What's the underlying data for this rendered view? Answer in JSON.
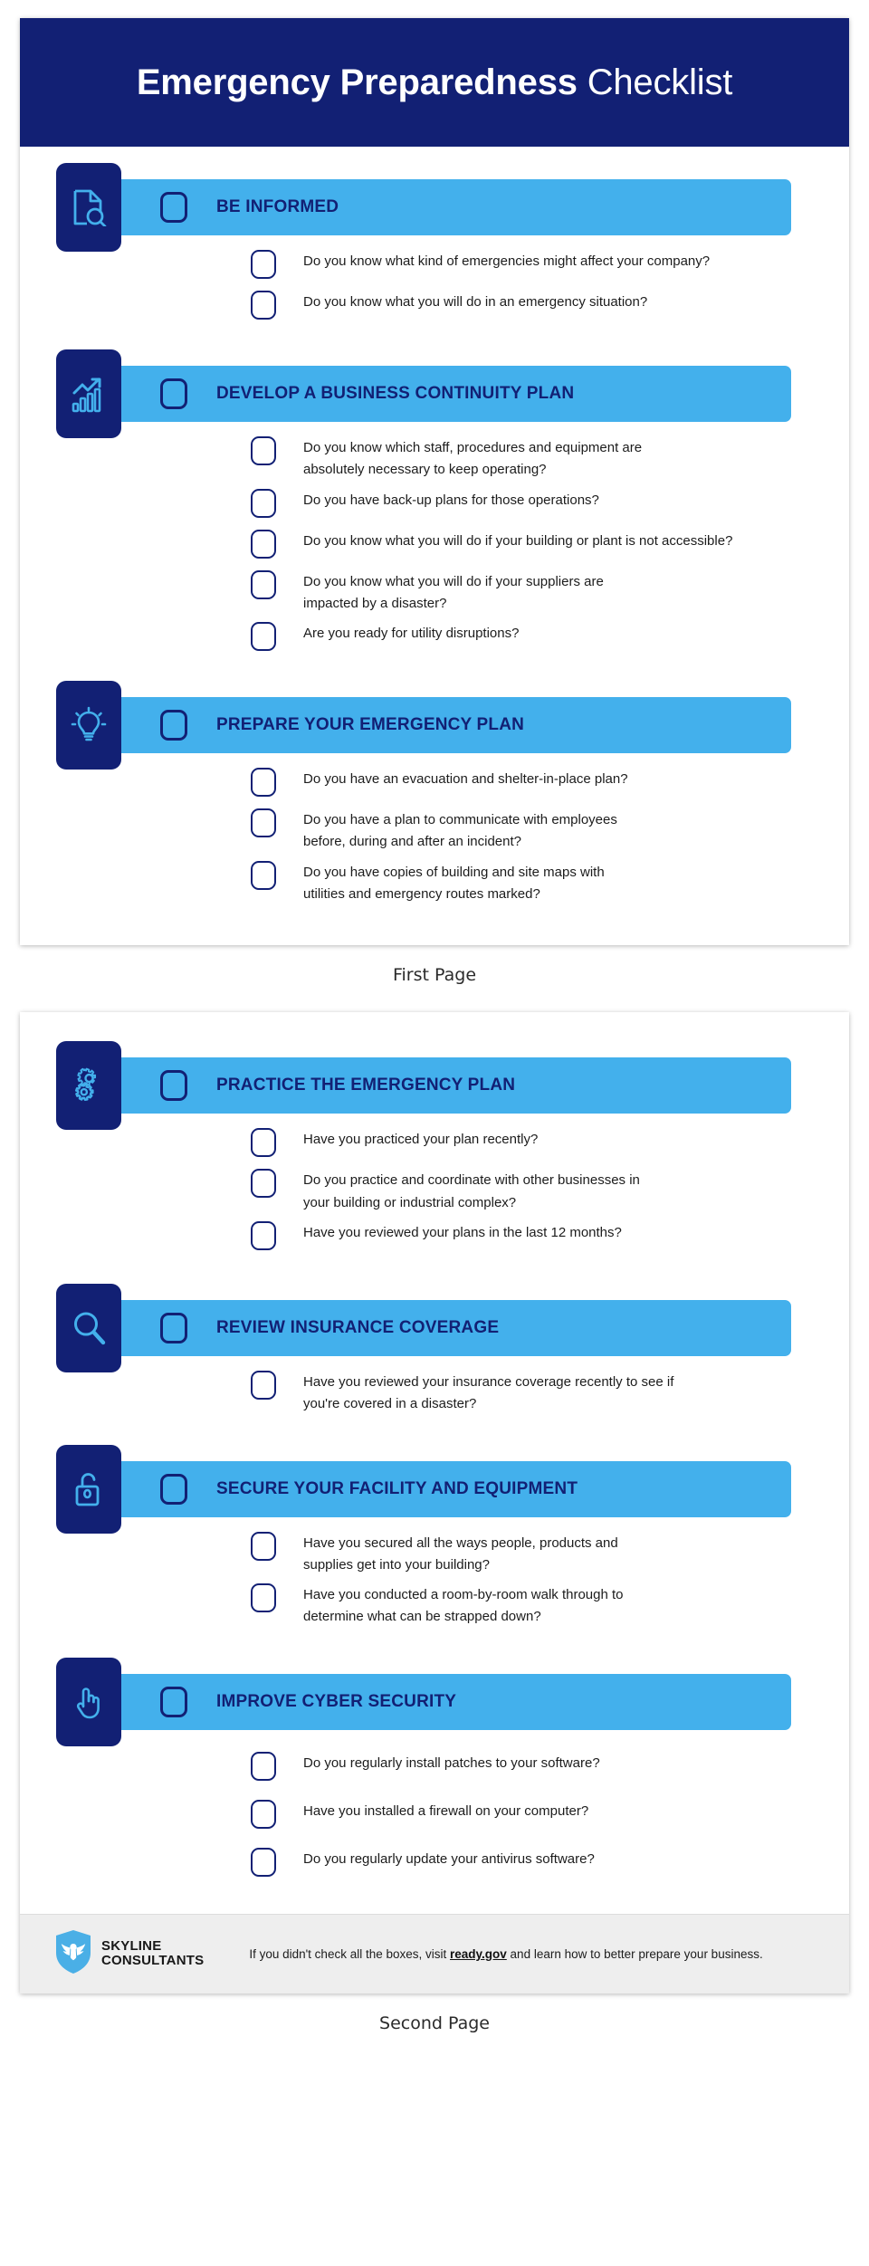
{
  "document": {
    "title_bold": "Emergency Preparedness",
    "title_light": " Checklist",
    "header_bg": "#122074",
    "accent_bar": "#43b0ec",
    "icon_tile_bg": "#122074"
  },
  "pages": [
    {
      "caption": "First Page",
      "sections": [
        {
          "icon": "document-search-icon",
          "title": "BE INFORMED",
          "questions": [
            "Do you know what kind of emergencies might affect your company?",
            "Do you know what you will do in an emergency situation?"
          ]
        },
        {
          "icon": "growth-chart-icon",
          "title": "DEVELOP A BUSINESS CONTINUITY PLAN",
          "questions": [
            "Do you know which staff, procedures and equipment are absolutely necessary to keep operating?",
            "Do you have back-up plans for those operations?",
            "Do you know what you will do if your building or plant is not accessible?",
            "Do you know what you will do if your suppliers are impacted by a disaster?",
            "Are you ready for utility disruptions?"
          ]
        },
        {
          "icon": "lightbulb-icon",
          "title": "PREPARE YOUR EMERGENCY PLAN",
          "questions": [
            "Do you have an evacuation and shelter-in-place plan?",
            "Do you have a plan to communicate with employees before, during and after an incident?",
            "Do you have copies of building and site maps with utilities and emergency routes marked?"
          ]
        }
      ]
    },
    {
      "caption": "Second Page",
      "sections": [
        {
          "icon": "gears-icon",
          "title": "PRACTICE THE EMERGENCY PLAN",
          "questions": [
            "Have you practiced your plan recently?",
            "Do you practice and coordinate with other businesses in your building or industrial complex?",
            "Have you reviewed your plans in the last 12 months?"
          ]
        },
        {
          "icon": "magnifier-icon",
          "title": "REVIEW INSURANCE COVERAGE",
          "questions": [
            "Have you reviewed your insurance coverage recently to see if you're covered in a disaster?"
          ]
        },
        {
          "icon": "padlock-icon",
          "title": "SECURE YOUR FACILITY AND EQUIPMENT",
          "questions": [
            "Have you secured all the ways people, products and supplies get into your building?",
            "Have you conducted a room-by-room walk through to determine what can be strapped down?"
          ]
        },
        {
          "icon": "hand-pointer-icon",
          "title": "IMPROVE CYBER SECURITY",
          "questions": [
            "Do you regularly install patches to your software?",
            "Have you installed a firewall on your computer?",
            "Do you regularly update your antivirus software?"
          ]
        }
      ],
      "footer": {
        "brand_line1": "SKYLINE",
        "brand_line2": "CONSULTANTS",
        "logo": "shield-eagle-logo",
        "note_before": "If you didn't check all the boxes, visit ",
        "note_link": "ready.gov",
        "note_after": " and learn how to better prepare your business."
      }
    }
  ]
}
